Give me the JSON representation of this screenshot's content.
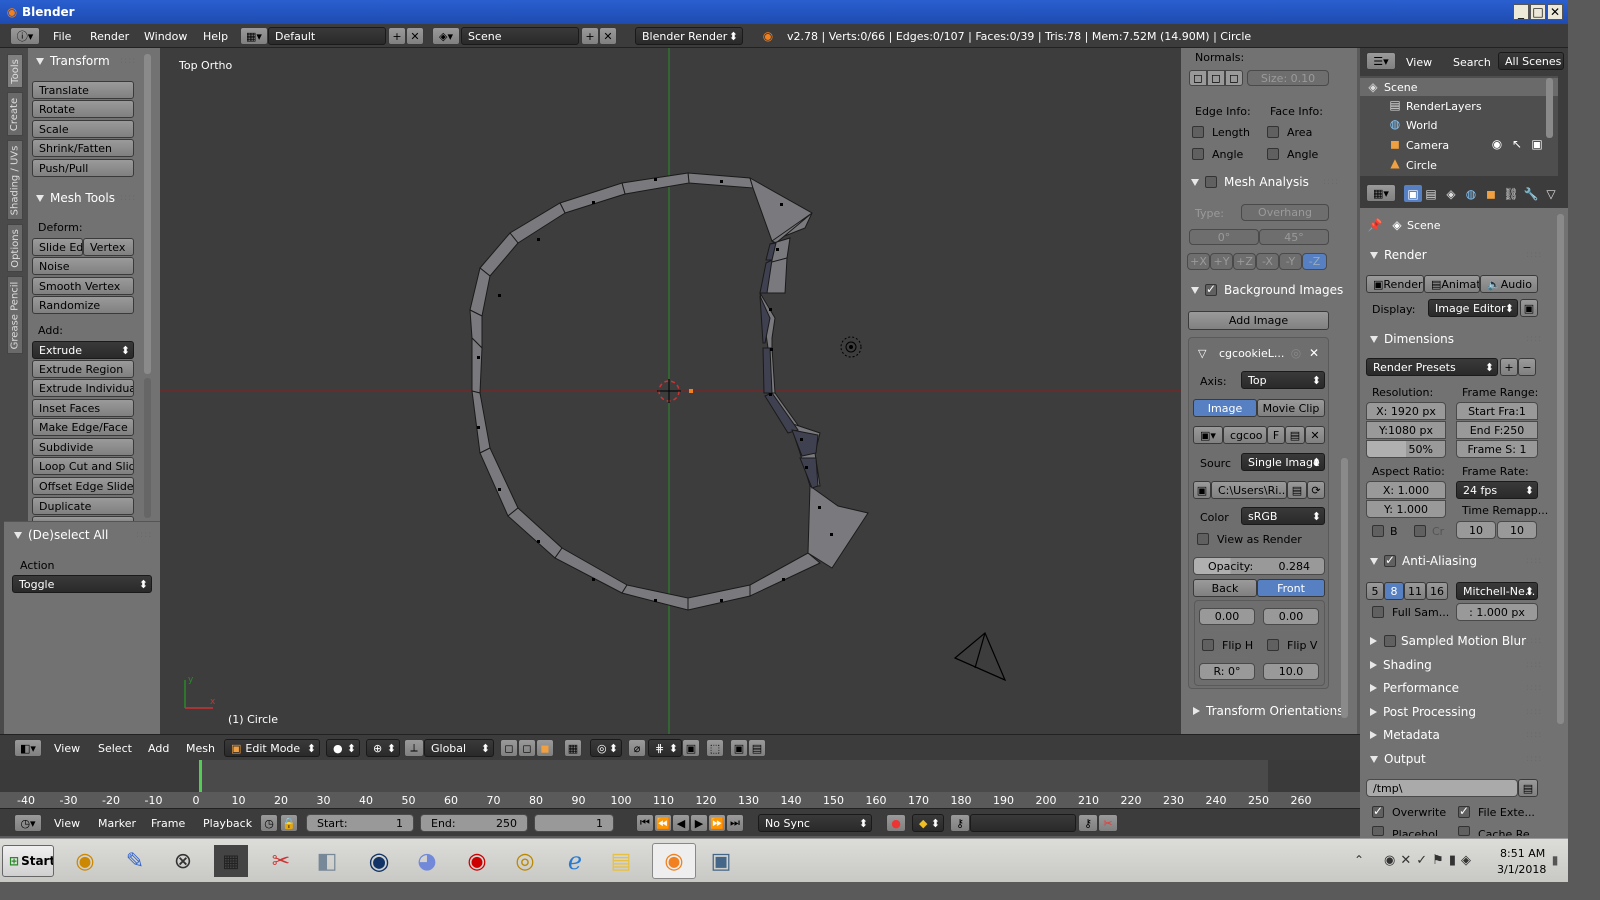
{
  "window": {
    "title": "Blender",
    "controls": [
      "_",
      "□",
      "✕"
    ]
  },
  "top_bar": {
    "menus": [
      "File",
      "Render",
      "Window",
      "Help"
    ],
    "layout": "Default",
    "scene": "Scene",
    "engine": "Blender Render",
    "stats": "v2.78 | Verts:0/66 | Edges:0/107 | Faces:0/39 | Tris:78 | Mem:7.52M (14.90M) | Circle"
  },
  "tool_tabs": [
    "Tools",
    "Create",
    "Shading / UVs",
    "Options",
    "Grease Pencil"
  ],
  "tools": {
    "transform": {
      "title": "Transform",
      "items": [
        "Translate",
        "Rotate",
        "Scale",
        "Shrink/Fatten",
        "Push/Pull"
      ]
    },
    "mesh_tools": {
      "title": "Mesh Tools",
      "deform_label": "Deform:",
      "deform_items": [
        "Slide Ed",
        "Vertex",
        "Noise",
        "Smooth Vertex",
        "Randomize"
      ],
      "add_label": "Add:",
      "extrude": "Extrude",
      "add_items": [
        "Extrude Region",
        "Extrude Individual",
        "Inset Faces",
        "Make Edge/Face",
        "Subdivide",
        "Loop Cut and Slide",
        "Offset Edge Slide",
        "Duplicate"
      ]
    },
    "deselect": {
      "title": "(De)select All",
      "action_label": "Action",
      "action_value": "Toggle"
    }
  },
  "viewport": {
    "view_name": "Top Ortho",
    "object_label": "(1) Circle"
  },
  "properties_panel": {
    "normals_label": "Normals:",
    "normals_size": "Size: 0.10",
    "edge_info": "Edge Info:",
    "face_info": "Face Info:",
    "edge_checks": [
      "Length",
      "Angle"
    ],
    "face_checks": [
      "Area",
      "Angle"
    ],
    "mesh_analysis": "Mesh Analysis",
    "type_label": "Type:",
    "type_value": "Overhang",
    "range_min": "0°",
    "range_max": "45°",
    "axes": [
      "+X",
      "+Y",
      "+Z",
      "-X",
      "-Y",
      "-Z"
    ],
    "background_images": "Background Images",
    "add_image": "Add Image",
    "image_name": "cgcookieL...",
    "axis_label": "Axis:",
    "axis_value": "Top",
    "tab_image": "Image",
    "tab_movie": "Movie Clip",
    "img_field": "cgcoo",
    "img_f": "F",
    "source_label": "Sourc",
    "source_value": "Single Image",
    "path": "C:\\Users\\Ri...",
    "color_label": "Color",
    "color_value": "sRGB",
    "view_as_render": "View as Render",
    "opacity_label": "Opacity:",
    "opacity_value": "0.284",
    "back": "Back",
    "front": "Front",
    "offset_x": "0.00",
    "offset_y": "0.00",
    "flip_h": "Flip H",
    "flip_v": "Flip V",
    "rotation": "R: 0°",
    "size": "10.0",
    "transform_orientations": "Transform Orientations"
  },
  "outliner": {
    "menus": [
      "View",
      "Search"
    ],
    "filter": "All Scenes",
    "items": [
      "Scene",
      "RenderLayers",
      "World",
      "Camera",
      "Circle"
    ]
  },
  "render_props": {
    "scene": "Scene",
    "render_title": "Render",
    "render_btns": [
      "Render",
      "Animati",
      "Audio"
    ],
    "display_label": "Display:",
    "display_value": "Image Editor",
    "dimensions": "Dimensions",
    "presets": "Render Presets",
    "resolution_label": "Resolution:",
    "frame_range_label": "Frame Range:",
    "res_x": "X: 1920 px",
    "res_y": "Y:1080 px",
    "res_pct": "50%",
    "start": "Start Fra:1",
    "end": "End F:250",
    "step": "Frame S: 1",
    "aspect_label": "Aspect Ratio:",
    "frame_rate_label": "Frame Rate:",
    "asp_x": "X:   1.000",
    "asp_y": "Y:   1.000",
    "fps": "24 fps",
    "time_remap": "Time Remapp...",
    "b": "B",
    "cr": "Cr",
    "remap_a": "10",
    "remap_b": "10",
    "anti_aliasing": "Anti-Aliasing",
    "aa_samples": [
      "5",
      "8",
      "11",
      "16"
    ],
    "aa_filter": "Mitchell-Ne...",
    "full_sample": "Full Sam...",
    "filter_size": ": 1.000 px",
    "collapsed": [
      "Sampled Motion Blur",
      "Shading",
      "Performance",
      "Post Processing",
      "Metadata"
    ],
    "output": "Output",
    "output_path": "/tmp\\",
    "overwrite": "Overwrite",
    "file_ext": "File Exte...",
    "placeholders": "Placehol...",
    "cache": "Cache Re..."
  },
  "view3d_header": {
    "menus": [
      "View",
      "Select",
      "Add",
      "Mesh"
    ],
    "mode": "Edit Mode",
    "orientation": "Global"
  },
  "timeline": {
    "ticks": [
      "-40",
      "-30",
      "-20",
      "-10",
      "0",
      "10",
      "20",
      "30",
      "40",
      "50",
      "60",
      "70",
      "80",
      "90",
      "100",
      "110",
      "120",
      "130",
      "140",
      "150",
      "160",
      "170",
      "180",
      "190",
      "200",
      "210",
      "220",
      "230",
      "240",
      "250",
      "260"
    ],
    "menus": [
      "View",
      "Marker",
      "Frame",
      "Playback"
    ],
    "start": "Start:",
    "start_v": "1",
    "end": "End:",
    "end_v": "250",
    "current": "1",
    "sync": "No Sync"
  },
  "taskbar": {
    "start": "Start",
    "time": "8:51 AM",
    "date": "3/1/2018"
  },
  "colors": {
    "background": "#3d3d3d",
    "panel": "#727272",
    "accent_blue": "#5680c2",
    "x_axis": "#8a2020",
    "y_axis": "#2a8a2a"
  }
}
